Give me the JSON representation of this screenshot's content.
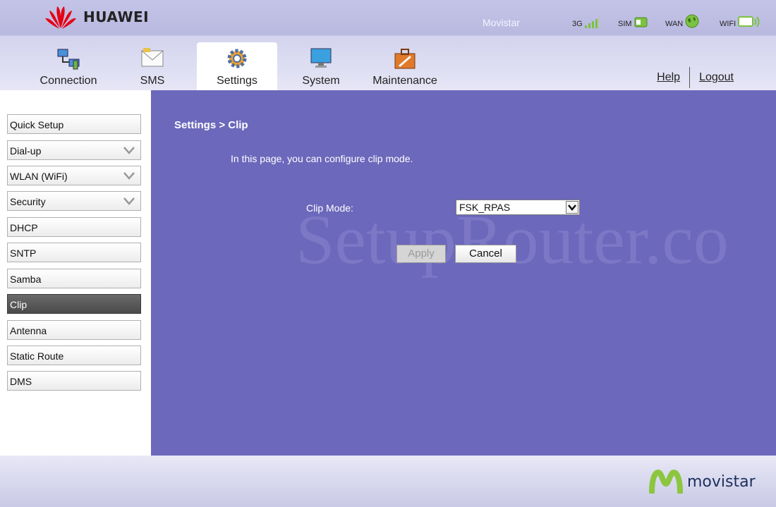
{
  "header": {
    "brand": "HUAWEI",
    "operator": "Movistar",
    "status": [
      {
        "label": "3G",
        "icon": "signal-bars-icon"
      },
      {
        "label": "SIM",
        "icon": "sim-card-icon"
      },
      {
        "label": "WAN",
        "icon": "globe-icon"
      },
      {
        "label": "WIFI",
        "icon": "wifi-icon"
      }
    ],
    "tabs": [
      {
        "label": "Connection",
        "icon": "network-computers-icon"
      },
      {
        "label": "SMS",
        "icon": "envelope-icon"
      },
      {
        "label": "Settings",
        "icon": "gear-icon"
      },
      {
        "label": "System",
        "icon": "monitor-icon"
      },
      {
        "label": "Maintenance",
        "icon": "toolbox-icon"
      }
    ],
    "active_tab": "Settings",
    "help": "Help",
    "logout": "Logout"
  },
  "sidebar": {
    "items": [
      {
        "label": "Quick Setup",
        "expandable": false
      },
      {
        "label": "Dial-up",
        "expandable": true
      },
      {
        "label": "WLAN (WiFi)",
        "expandable": true
      },
      {
        "label": "Security",
        "expandable": true
      },
      {
        "label": "DHCP",
        "expandable": false
      },
      {
        "label": "SNTP",
        "expandable": false
      },
      {
        "label": "Samba",
        "expandable": false
      },
      {
        "label": "Clip",
        "expandable": false,
        "active": true
      },
      {
        "label": "Antenna",
        "expandable": false
      },
      {
        "label": "Static Route",
        "expandable": false
      },
      {
        "label": "DMS",
        "expandable": false
      }
    ]
  },
  "main": {
    "title": "Settings > Clip",
    "description": "In this page, you can configure clip mode.",
    "clip_mode_label": "Clip Mode:",
    "clip_mode_value": "FSK_RPAS",
    "apply_label": "Apply",
    "cancel_label": "Cancel",
    "watermark": "SetupRouter.co"
  },
  "footer": {
    "brand": "movistar"
  },
  "colors": {
    "main_bg": "#6c68bb",
    "header_bg": "#c4c4e8",
    "accent_green": "#7cc242",
    "huawei_red": "#e60012",
    "movistar_green": "#8cc63f"
  }
}
